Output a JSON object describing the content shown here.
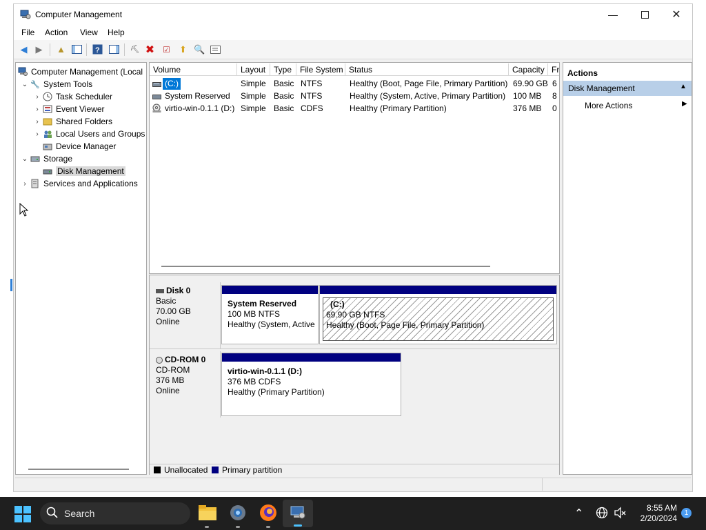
{
  "window": {
    "title": "Computer Management",
    "controls": [
      "minimize",
      "maximize",
      "close"
    ]
  },
  "menu": [
    "File",
    "Action",
    "View",
    "Help"
  ],
  "tree": {
    "root": "Computer Management (Local",
    "items": [
      {
        "label": "System Tools",
        "expanded": true
      },
      {
        "label": "Task Scheduler"
      },
      {
        "label": "Event Viewer"
      },
      {
        "label": "Shared Folders"
      },
      {
        "label": "Local Users and Groups"
      },
      {
        "label": "Device Manager"
      },
      {
        "label": "Storage",
        "expanded": true
      },
      {
        "label": "Disk Management",
        "selected": true
      },
      {
        "label": "Services and Applications"
      }
    ]
  },
  "volume_list": {
    "columns": [
      "Volume",
      "Layout",
      "Type",
      "File System",
      "Status",
      "Capacity",
      "Fr"
    ],
    "rows": [
      {
        "volume": "(C:)",
        "layout": "Simple",
        "type": "Basic",
        "fs": "NTFS",
        "status": "Healthy (Boot, Page File, Primary Partition)",
        "capacity": "69.90 GB",
        "free": "6"
      },
      {
        "volume": "System Reserved",
        "layout": "Simple",
        "type": "Basic",
        "fs": "NTFS",
        "status": "Healthy (System, Active, Primary Partition)",
        "capacity": "100 MB",
        "free": "8"
      },
      {
        "volume": "virtio-win-0.1.1 (D:)",
        "layout": "Simple",
        "type": "Basic",
        "fs": "CDFS",
        "status": "Healthy (Primary Partition)",
        "capacity": "376 MB",
        "free": "0"
      }
    ]
  },
  "disks": [
    {
      "name": "Disk 0",
      "kind": "Basic",
      "size": "70.00 GB",
      "state": "Online",
      "partitions": [
        {
          "name": "System Reserved",
          "detail": "100 MB NTFS",
          "status": "Healthy (System, Active,"
        },
        {
          "name": "(C:)",
          "detail": "69.90 GB NTFS",
          "status": "Healthy (Boot, Page File, Primary Partition)"
        }
      ]
    },
    {
      "name": "CD-ROM 0",
      "kind": "CD-ROM",
      "size": "376 MB",
      "state": "Online",
      "partitions": [
        {
          "name": "virtio-win-0.1.1  (D:)",
          "detail": "376 MB CDFS",
          "status": "Healthy (Primary Partition)"
        }
      ]
    }
  ],
  "legend": {
    "unallocated": "Unallocated",
    "primary": "Primary partition",
    "colors": {
      "unallocated": "#000000",
      "primary": "#000080"
    }
  },
  "actions": {
    "header": "Actions",
    "section": "Disk Management",
    "more": "More Actions"
  },
  "taskbar": {
    "search": "Search",
    "time": "8:55 AM",
    "date": "2/20/2024",
    "notification_count": "1"
  }
}
